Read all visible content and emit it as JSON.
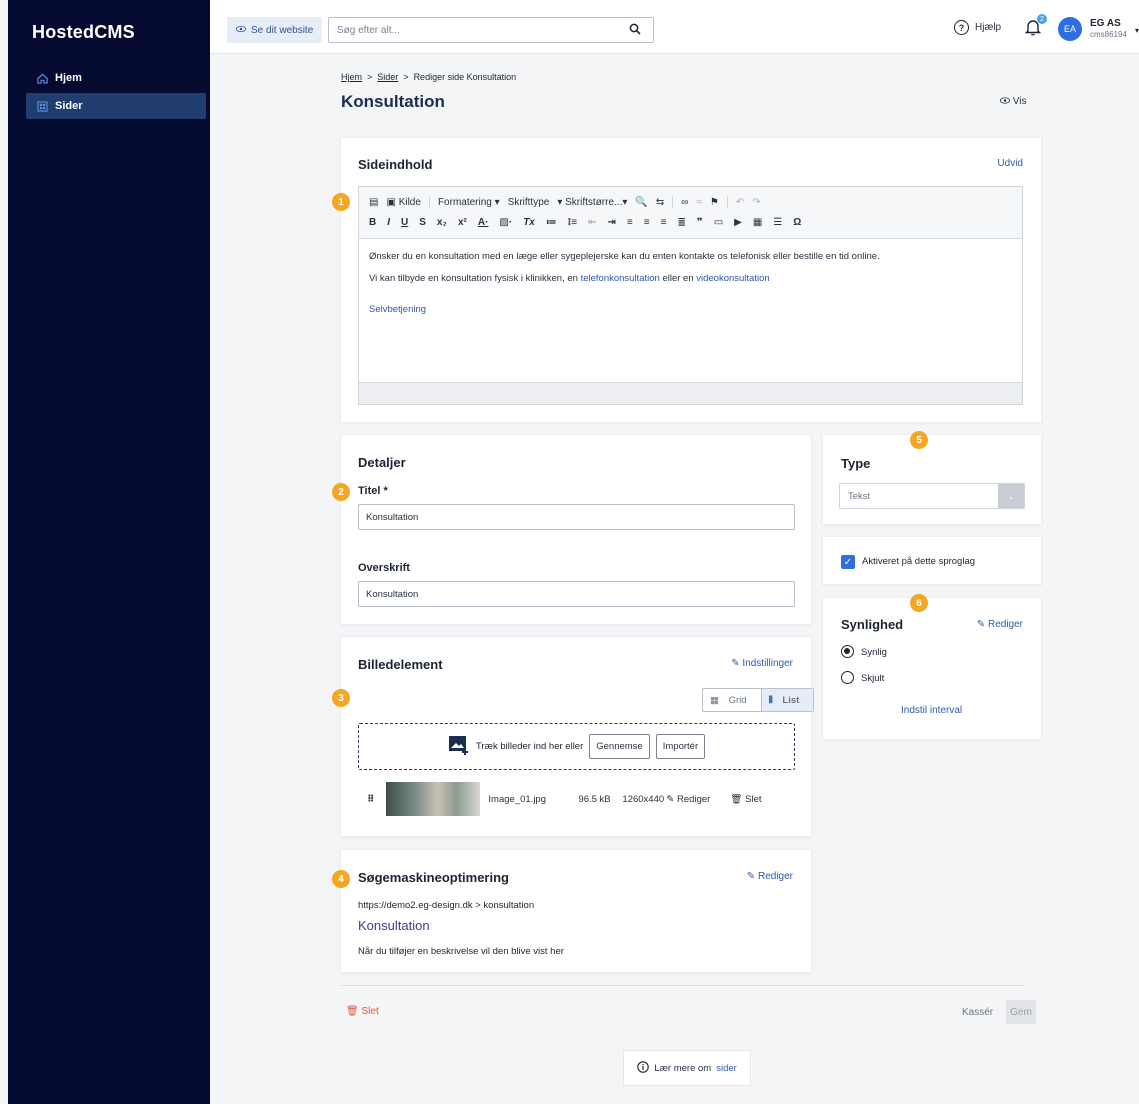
{
  "app": {
    "brand": "HostedCMS"
  },
  "sidebar": {
    "items": [
      {
        "label": "Hjem",
        "icon": "home-icon"
      },
      {
        "label": "Sider",
        "icon": "pages-icon",
        "active": true
      }
    ]
  },
  "topbar": {
    "see_site": "Se dit website",
    "search_placeholder": "Søg efter alt...",
    "help": "Hjælp",
    "notifications_count": "2",
    "avatar_initials": "EA",
    "account_name": "EG AS",
    "account_id": "cms86194"
  },
  "breadcrumb": {
    "home": "Hjem",
    "pages": "Sider",
    "current": "Rediger side Konsultation",
    "sep": ">"
  },
  "page": {
    "title": "Konsultation",
    "view": "Vis"
  },
  "content": {
    "title": "Sideindhold",
    "expand": "Udvid",
    "badge": "1",
    "toolbar_row1": [
      "Kilde",
      "Formatering ▾",
      "Skrifttype",
      "▾ Skriftstørre...▾"
    ],
    "toolbar_row2": [
      "B",
      "I",
      "U",
      "S",
      "x₂",
      "x²",
      "A·",
      "Tx",
      "Ω"
    ],
    "paragraph1": "Ønsker du en konsultation med en læge eller sygeplejerske kan du enten kontakte os telefonisk eller bestille en tid online.",
    "paragraph2_pre": "Vi kan tilbyde en konsultation fysisk i klinikken, en ",
    "paragraph2_link1": "telefonkonsultation",
    "paragraph2_mid": " eller en ",
    "paragraph2_link2": "videokonsultation",
    "selfservice": "Selvbetjening"
  },
  "details": {
    "title": "Detaljer",
    "badge": "2",
    "title_label": "Titel *",
    "title_value": "Konsultation",
    "heading_label": "Overskrift",
    "heading_value": "Konsultation"
  },
  "image": {
    "title": "Billedelement",
    "badge": "3",
    "settings": "Indstillinger",
    "grid": "Grid",
    "list": "List",
    "drop_text": "Træk billeder ind her eller",
    "browse": "Gennemse",
    "import": "Importér",
    "file_name": "Image_01.jpg",
    "file_size": "96.5 kB",
    "dimensions": "1260x440",
    "edit": "Rediger",
    "delete": "Slet"
  },
  "seo": {
    "title": "Søgemaskineoptimering",
    "badge": "4",
    "edit": "Rediger",
    "url": "https://demo2.eg-design.dk > konsultation",
    "page_title": "Konsultation",
    "description": "Når du tilføjer en beskrivelse vil den blive vist her"
  },
  "type": {
    "title": "Type",
    "badge": "5",
    "selected": "Tekst"
  },
  "language": {
    "label": "Aktiveret på dette sproglag",
    "checked": true
  },
  "visibility": {
    "title": "Synlighed",
    "badge": "6",
    "edit": "Rediger",
    "option_visible": "Synlig",
    "option_hidden": "Skjult",
    "interval": "Indstil interval"
  },
  "footer": {
    "delete": "Slet",
    "discard": "Kassér",
    "save": "Gem"
  },
  "learn": {
    "prefix": "Lær mere om",
    "link": "sider"
  },
  "colors": {
    "sidebar": "#050a30",
    "active": "#1f3d6e",
    "accent": "#2d5aa8",
    "badge": "#f5a623",
    "danger": "#e0553a"
  }
}
